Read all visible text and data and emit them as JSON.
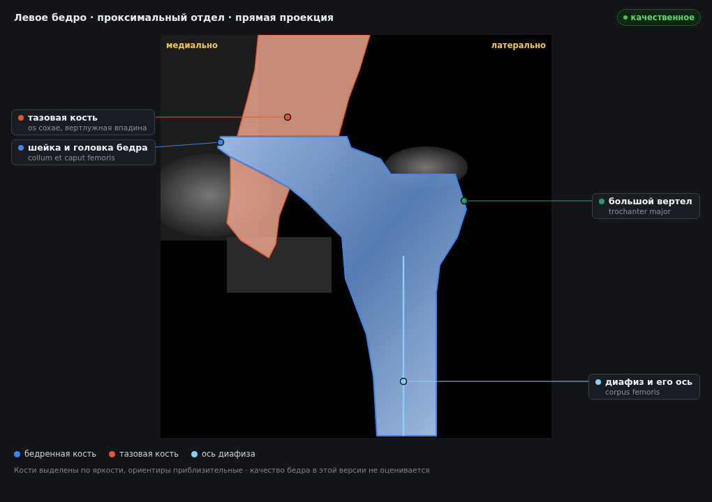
{
  "header": {
    "title": "Левое бедро · проксимальный отдел · прямая проекция",
    "badge": "качественное"
  },
  "image": {
    "orientation_labels": [
      "медиально",
      "латерально"
    ]
  },
  "callouts": [
    {
      "title": "тазовая кость",
      "subtitle": "os coxae, вертлужная впадина",
      "color": "#e4572e"
    },
    {
      "title": "шейка и головка бедра",
      "subtitle": "collum et caput femoris",
      "color": "#3b86ea"
    },
    {
      "title": "большой вертел",
      "subtitle": "trochanter major",
      "color": "#1f9d6a"
    },
    {
      "title": "диафиз и его ось",
      "subtitle": "corpus femoris",
      "color": "#7dd3fc"
    }
  ],
  "legend": [
    {
      "label": "бедренная кость",
      "color": "#3b86ea"
    },
    {
      "label": "тазовая кость",
      "color": "#e4572e"
    },
    {
      "label": "ось диафиза",
      "color": "#7dd3fc"
    }
  ],
  "footnote": "Кости выделены по яркости, ориентиры приблизительные · качество бедра в этой версии не оценивается"
}
